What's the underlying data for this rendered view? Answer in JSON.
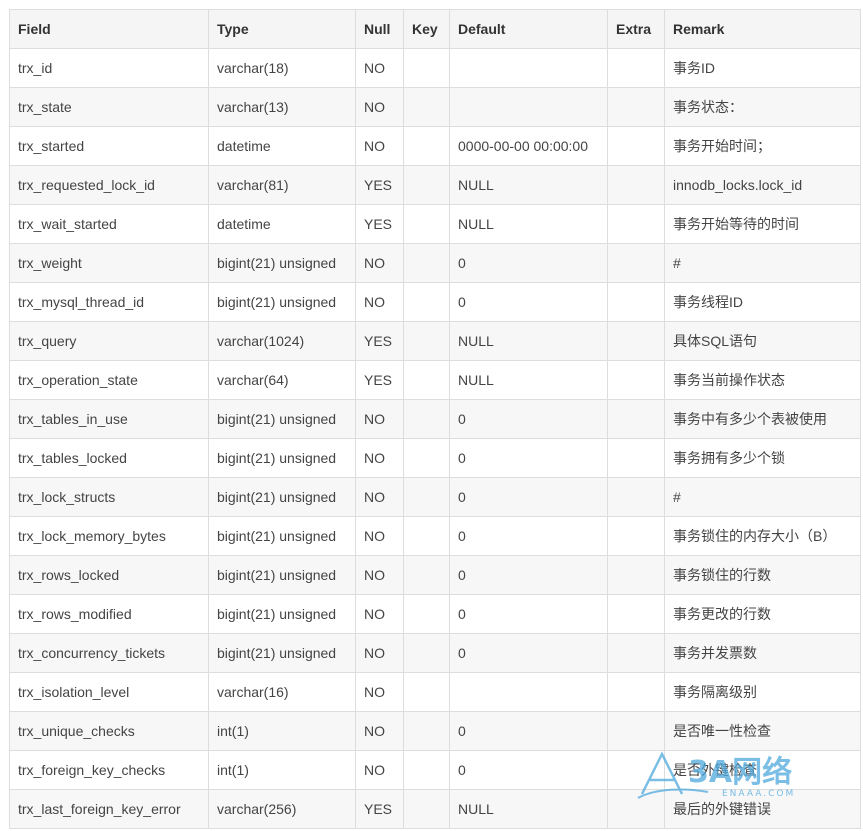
{
  "table": {
    "headers": [
      "Field",
      "Type",
      "Null",
      "Key",
      "Default",
      "Extra",
      "Remark"
    ],
    "rows": [
      [
        "trx_id",
        "varchar(18)",
        "NO",
        "",
        "",
        "",
        "事务ID"
      ],
      [
        "trx_state",
        "varchar(13)",
        "NO",
        "",
        "",
        "",
        "事务状态："
      ],
      [
        "trx_started",
        "datetime",
        "NO",
        "",
        "0000-00-00 00:00:00",
        "",
        "事务开始时间；"
      ],
      [
        "trx_requested_lock_id",
        "varchar(81)",
        "YES",
        "",
        "NULL",
        "",
        "innodb_locks.lock_id"
      ],
      [
        "trx_wait_started",
        "datetime",
        "YES",
        "",
        "NULL",
        "",
        "事务开始等待的时间"
      ],
      [
        "trx_weight",
        "bigint(21) unsigned",
        "NO",
        "",
        "0",
        "",
        "#"
      ],
      [
        "trx_mysql_thread_id",
        "bigint(21) unsigned",
        "NO",
        "",
        "0",
        "",
        "事务线程ID"
      ],
      [
        "trx_query",
        "varchar(1024)",
        "YES",
        "",
        "NULL",
        "",
        "具体SQL语句"
      ],
      [
        "trx_operation_state",
        "varchar(64)",
        "YES",
        "",
        "NULL",
        "",
        "事务当前操作状态"
      ],
      [
        "trx_tables_in_use",
        "bigint(21) unsigned",
        "NO",
        "",
        "0",
        "",
        "事务中有多少个表被使用"
      ],
      [
        "trx_tables_locked",
        "bigint(21) unsigned",
        "NO",
        "",
        "0",
        "",
        "事务拥有多少个锁"
      ],
      [
        "trx_lock_structs",
        "bigint(21) unsigned",
        "NO",
        "",
        "0",
        "",
        "#"
      ],
      [
        "trx_lock_memory_bytes",
        "bigint(21) unsigned",
        "NO",
        "",
        "0",
        "",
        "事务锁住的内存大小（B）"
      ],
      [
        "trx_rows_locked",
        "bigint(21) unsigned",
        "NO",
        "",
        "0",
        "",
        "事务锁住的行数"
      ],
      [
        "trx_rows_modified",
        "bigint(21) unsigned",
        "NO",
        "",
        "0",
        "",
        "事务更改的行数"
      ],
      [
        "trx_concurrency_tickets",
        "bigint(21) unsigned",
        "NO",
        "",
        "0",
        "",
        "事务并发票数"
      ],
      [
        "trx_isolation_level",
        "varchar(16)",
        "NO",
        "",
        "",
        "",
        "事务隔离级别"
      ],
      [
        "trx_unique_checks",
        "int(1)",
        "NO",
        "",
        "0",
        "",
        "是否唯一性检查"
      ],
      [
        "trx_foreign_key_checks",
        "int(1)",
        "NO",
        "",
        "0",
        "",
        "是否外键检查"
      ],
      [
        "trx_last_foreign_key_error",
        "varchar(256)",
        "YES",
        "",
        "NULL",
        "",
        "最后的外键错误"
      ]
    ]
  },
  "watermark": {
    "brand": "3A网络",
    "domain": "ENAAA.COM"
  },
  "colors": {
    "border": "#dddddd",
    "header_bg": "#f5f5f5",
    "stripe_bg": "#f7f7f7",
    "text": "#444444",
    "watermark": "#4fa9dd"
  }
}
